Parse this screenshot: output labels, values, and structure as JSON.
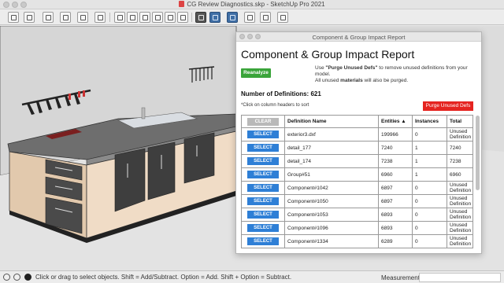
{
  "window": {
    "title": "CG Review Diagnostics.skp - SketchUp Pro 2021"
  },
  "toolbar": {
    "icons": [
      "open-file-icon",
      "save-icon",
      "new-file-icon",
      "home-icon",
      "parallel-projection-icon",
      "perspective-icon",
      "x-ray-icon",
      "style-back-edges-icon",
      "wireframe-icon",
      "hidden-line-icon",
      "shaded-icon",
      "shaded-textures-icon",
      "monochrome-icon",
      "component-browser-icon",
      "warehouse-icon",
      "extension-icon",
      "upload-icon",
      "sync-icon",
      "account-icon"
    ]
  },
  "report": {
    "dialog_title": "Component & Group Impact Report",
    "heading": "Component & Group Impact Report",
    "reanalyze_label": "Reanalyze",
    "help_line1_prefix": "Use ",
    "help_line1_bold": "\"Purge Unused Defs\"",
    "help_line1_suffix": " to remove unused definitions from your",
    "help_line2": "model.",
    "help_line3_prefix": "All unused ",
    "help_line3_bold": "materials",
    "help_line3_suffix": " will also be purged.",
    "num_defs_label": "Number of Definitions: ",
    "num_defs_value": "621",
    "sort_note": "*Click on column headers to sort",
    "purge_label": "Purge Unused Defs",
    "table": {
      "clear_label": "CLEAR",
      "headers": {
        "name": "Definition Name",
        "entities": "Entities ▲",
        "instances": "Instances",
        "total": "Total"
      },
      "rows": [
        {
          "select": "SELECT",
          "name": "exterior3.dxf",
          "entities": "199966",
          "instances": "0",
          "total": "Unused Definition"
        },
        {
          "select": "SELECT",
          "name": "detail_177",
          "entities": "7240",
          "instances": "1",
          "total": "7240"
        },
        {
          "select": "SELECT",
          "name": "detail_174",
          "entities": "7238",
          "instances": "1",
          "total": "7238"
        },
        {
          "select": "SELECT",
          "name": "Group#51",
          "entities": "6960",
          "instances": "1",
          "total": "6960"
        },
        {
          "select": "SELECT",
          "name": "Component#1042",
          "entities": "6897",
          "instances": "0",
          "total": "Unused Definition"
        },
        {
          "select": "SELECT",
          "name": "Component#1050",
          "entities": "6897",
          "instances": "0",
          "total": "Unused Definition"
        },
        {
          "select": "SELECT",
          "name": "Component#1053",
          "entities": "6893",
          "instances": "0",
          "total": "Unused Definition"
        },
        {
          "select": "SELECT",
          "name": "Component#1096",
          "entities": "6893",
          "instances": "0",
          "total": "Unused Definition"
        },
        {
          "select": "SELECT",
          "name": "Component#1334",
          "entities": "6289",
          "instances": "0",
          "total": "Unused Definition"
        }
      ]
    }
  },
  "statusbar": {
    "message": "Click or drag to select objects. Shift = Add/Subtract. Option = Add. Shift + Option = Subtract.",
    "measurements_label": "Measurements",
    "measurements_value": ""
  },
  "colors": {
    "reanalyze": "#3aa43a",
    "purge": "#e52420",
    "select_button": "#2e7fd6",
    "clear_button": "#b9b9b9"
  }
}
